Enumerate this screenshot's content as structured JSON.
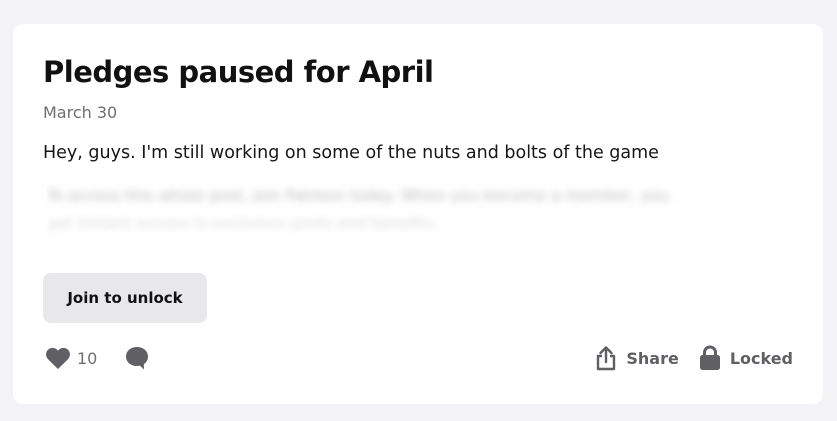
{
  "post": {
    "title": "Pledges paused for April",
    "date": "March 30",
    "excerpt": "Hey, guys. I'm still working on some of the nuts and bolts of the game",
    "locked_teaser": [
      "To access this whole post, join Patreon today. When you become a member, you",
      "get instant access to exclusive posts and benefits."
    ]
  },
  "actions": {
    "join_label": "Join to unlock",
    "like_count": "10",
    "share_label": "Share",
    "locked_label": "Locked"
  },
  "icons": {
    "like": "heart-icon",
    "comment": "comment-icon",
    "share": "share-icon",
    "locked": "lock-icon"
  },
  "colors": {
    "background": "#f3f2f4",
    "card": "#ffffff",
    "button": "#e8e7ea",
    "icon": "#5f5f64"
  }
}
